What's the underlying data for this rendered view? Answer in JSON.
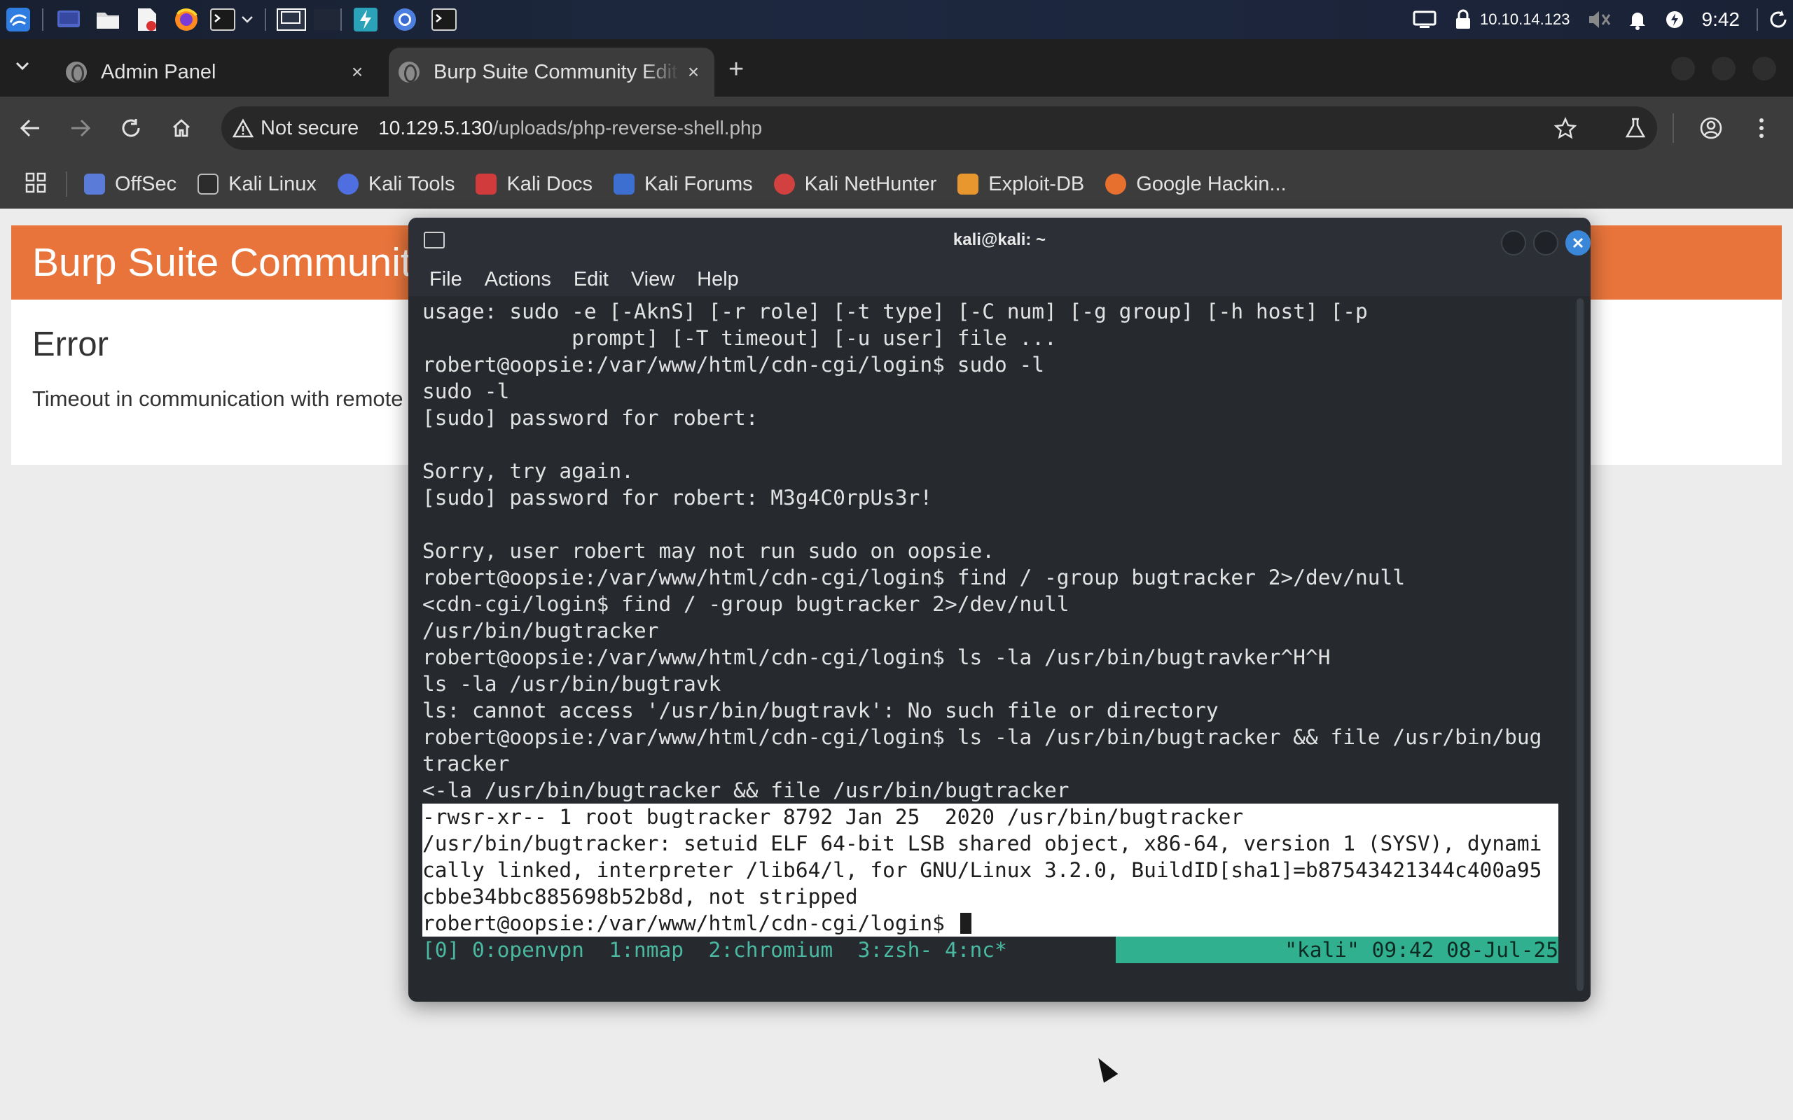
{
  "taskbar": {
    "ip": "10.10.14.123",
    "clock": "9:42"
  },
  "tabs": [
    {
      "title": "Admin Panel",
      "close": "×"
    },
    {
      "title": "Burp Suite Community Edition",
      "close": "×"
    }
  ],
  "toolbar": {
    "security_label": "Not secure",
    "url_host": "10.129.5.130",
    "url_path": "/uploads/php-reverse-shell.php"
  },
  "bookmarks": [
    {
      "label": "OffSec",
      "color": "#5a7bd8"
    },
    {
      "label": "Kali Linux",
      "color": "#2c2c2c"
    },
    {
      "label": "Kali Tools",
      "color": "#4f6fe0"
    },
    {
      "label": "Kali Docs",
      "color": "#d23b3b"
    },
    {
      "label": "Kali Forums",
      "color": "#3c6fd0"
    },
    {
      "label": "Kali NetHunter",
      "color": "#d24040"
    },
    {
      "label": "Exploit-DB",
      "color": "#e8962e"
    },
    {
      "label": "Google Hackin...",
      "color": "#e8702e"
    }
  ],
  "page": {
    "header_title": "Burp Suite Community Edition",
    "error_heading": "Error",
    "error_message": "Timeout in communication with remote server",
    "header_color": "#e8743b"
  },
  "terminal": {
    "title": "kali@kali: ~",
    "menu": [
      "File",
      "Actions",
      "Edit",
      "View",
      "Help"
    ],
    "lines": [
      "usage: sudo -e [-AknS] [-r role] [-t type] [-C num] [-g group] [-h host] [-p",
      "            prompt] [-T timeout] [-u user] file ...",
      "robert@oopsie:/var/www/html/cdn-cgi/login$ sudo -l",
      "sudo -l",
      "[sudo] password for robert:",
      "",
      "Sorry, try again.",
      "[sudo] password for robert: M3g4C0rpUs3r!",
      "",
      "Sorry, user robert may not run sudo on oopsie.",
      "robert@oopsie:/var/www/html/cdn-cgi/login$ find / -group bugtracker 2>/dev/null",
      "<cdn-cgi/login$ find / -group bugtracker 2>/dev/null",
      "/usr/bin/bugtracker",
      "robert@oopsie:/var/www/html/cdn-cgi/login$ ls -la /usr/bin/bugtravker^H^H",
      "ls -la /usr/bin/bugtravk",
      "ls: cannot access '/usr/bin/bugtravk': No such file or directory",
      "robert@oopsie:/var/www/html/cdn-cgi/login$ ls -la /usr/bin/bugtracker && file /usr/bin/bug",
      "tracker",
      "<-la /usr/bin/bugtracker && file /usr/bin/bugtracker"
    ],
    "highlighted_lines": [
      "-rwsr-xr-- 1 root bugtracker 8792 Jan 25  2020 /usr/bin/bugtracker",
      "/usr/bin/bugtracker: setuid ELF 64-bit LSB shared object, x86-64, version 1 (SYSV), dynami",
      "cally linked, interpreter /lib64/l, for GNU/Linux 3.2.0, BuildID[sha1]=b87543421344c400a95",
      "cbbe34bbc885698b52b8d, not stripped"
    ],
    "prompt": "robert@oopsie:/var/www/html/cdn-cgi/login$ ",
    "tmux_left": "[0] 0:openvpn  1:nmap  2:chromium  3:zsh- 4:nc*",
    "tmux_right": "\"kali\" 09:42 08-Jul-25"
  }
}
